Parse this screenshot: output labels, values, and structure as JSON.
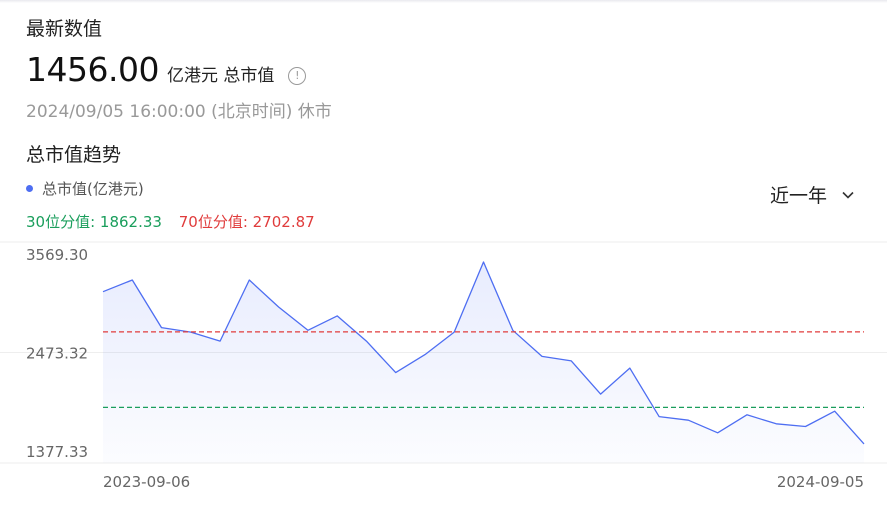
{
  "header": {
    "latest_label": "最新数值",
    "value": "1456.00",
    "unit": "亿港元 总市值",
    "timestamp": "2024/09/05 16:00:00 (北京时间) 休市",
    "info_icon": "info-icon"
  },
  "section_title": "总市值趋势",
  "legend_label": "总市值(亿港元)",
  "percentiles": {
    "p30_label": "30位分值: 1862.33",
    "p70_label": "70位分值: 2702.87"
  },
  "range_select": {
    "label": "近一年",
    "icon": "chevron-down-icon"
  },
  "colors": {
    "line": "#4e6ef2",
    "p30": "#1a9e5c",
    "p70": "#e03c3c"
  },
  "chart_data": {
    "type": "area",
    "series": [
      {
        "name": "总市值(亿港元)",
        "x": [
          "2023-09-06",
          "2023-09-20",
          "2023-10-04",
          "2023-10-18",
          "2023-11-01",
          "2023-11-15",
          "2023-11-29",
          "2023-12-13",
          "2023-12-27",
          "2024-01-10",
          "2024-01-24",
          "2024-02-07",
          "2024-02-21",
          "2024-03-06",
          "2024-03-20",
          "2024-04-03",
          "2024-04-17",
          "2024-05-01",
          "2024-05-15",
          "2024-05-29",
          "2024-06-12",
          "2024-06-26",
          "2024-07-10",
          "2024-07-24",
          "2024-08-07",
          "2024-08-21",
          "2024-09-05"
        ],
        "values": [
          3150,
          3280,
          2750,
          2700,
          2600,
          3280,
          2980,
          2720,
          2880,
          2600,
          2250,
          2450,
          2700,
          3480,
          2720,
          2430,
          2380,
          2010,
          2300,
          1760,
          1720,
          1580,
          1780,
          1680,
          1650,
          1820,
          1456
        ]
      }
    ],
    "percentile_lines": [
      {
        "label": "30位分值",
        "value": 1862.33
      },
      {
        "label": "70位分值",
        "value": 2702.87
      }
    ],
    "y_ticks": [
      "3569.30",
      "2473.32",
      "1377.33"
    ],
    "x_ticks": [
      "2023-09-06",
      "2024-09-05"
    ],
    "ylim": [
      1377.33,
      3569.3
    ],
    "grid": true
  }
}
